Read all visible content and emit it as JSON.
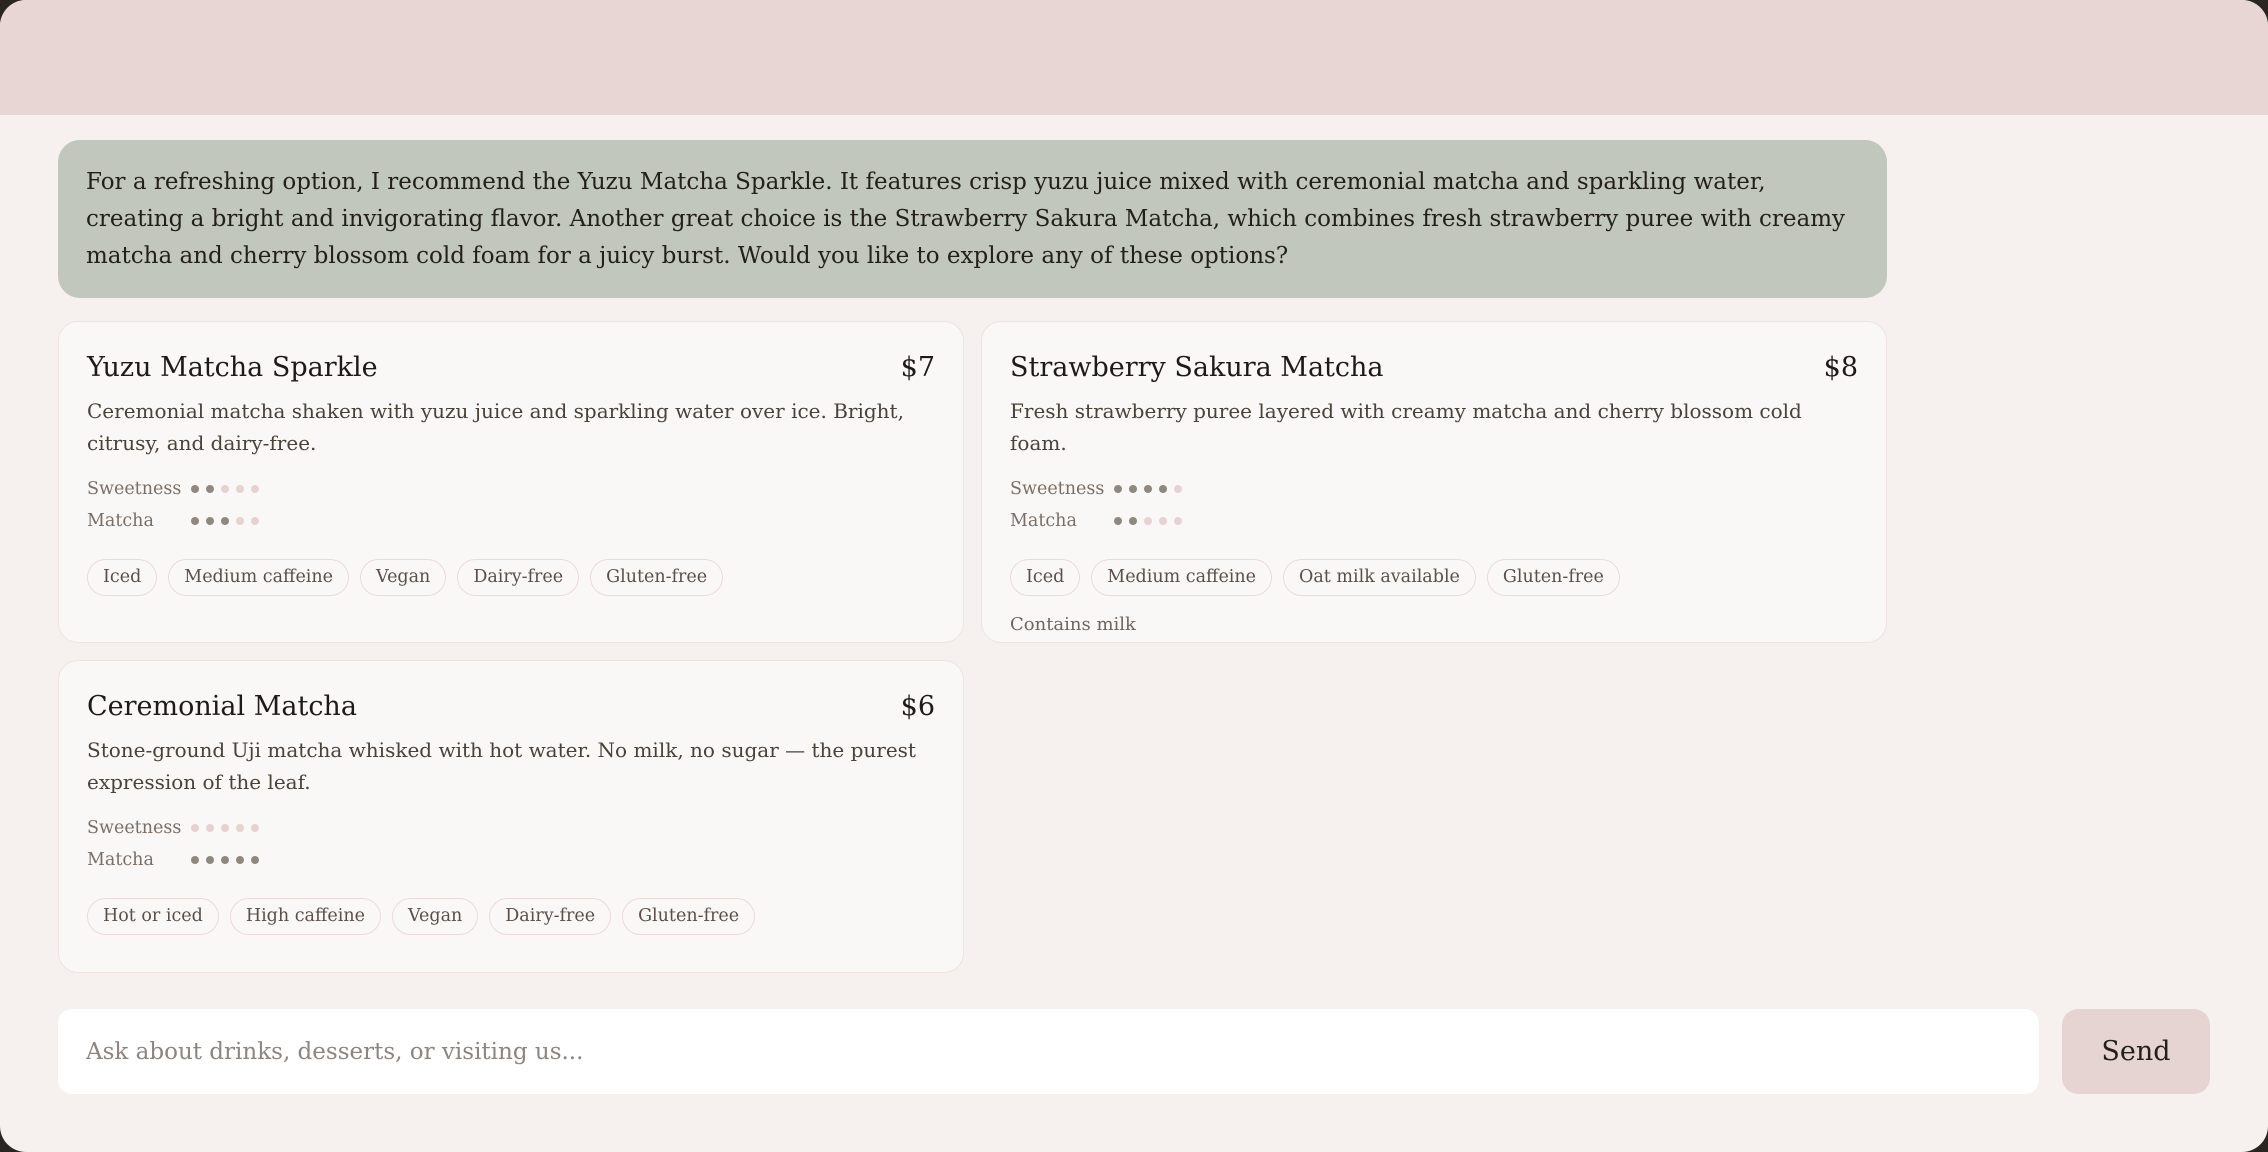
{
  "assistant_message": "For a refreshing option, I recommend the Yuzu Matcha Sparkle. It features crisp yuzu juice mixed with ceremonial matcha and sparkling water, creating a bright and invigorating flavor. Another great choice is the Strawberry Sakura Matcha, which combines fresh strawberry puree with creamy matcha and cherry blossom cold foam for a juicy burst. Would you like to explore any of these options?",
  "cards": [
    {
      "title": "Yuzu Matcha Sparkle",
      "price": "$7",
      "description": "Ceremonial matcha shaken with yuzu juice and sparkling water over ice. Bright, citrusy, and dairy-free.",
      "sweetness_label": "Sweetness",
      "sweetness_level": 2,
      "matcha_label": "Matcha",
      "matcha_level": 3,
      "tags": [
        "Iced",
        "Medium caffeine",
        "Vegan",
        "Dairy-free",
        "Gluten-free"
      ]
    },
    {
      "title": "Strawberry Sakura Matcha",
      "price": "$8",
      "description": "Fresh strawberry puree layered with creamy matcha and cherry blossom cold foam.",
      "sweetness_label": "Sweetness",
      "sweetness_level": 4,
      "matcha_label": "Matcha",
      "matcha_level": 2,
      "tags": [
        "Iced",
        "Medium caffeine",
        "Oat milk available",
        "Gluten-free"
      ],
      "note": "Contains milk"
    },
    {
      "title": "Ceremonial Matcha",
      "price": "$6",
      "description": "Stone-ground Uji matcha whisked with hot water. No milk, no sugar — the purest expression of the leaf.",
      "sweetness_label": "Sweetness",
      "sweetness_level": 0,
      "matcha_label": "Matcha",
      "matcha_level": 5,
      "tags": [
        "Hot or iced",
        "High caffeine",
        "Vegan",
        "Dairy-free",
        "Gluten-free"
      ]
    }
  ],
  "meter_max": 5,
  "composer": {
    "placeholder": "Ask about drinks, desserts, or visiting us...",
    "value": "",
    "send_label": "Send"
  },
  "colors": {
    "header_band": "#e8d6d5",
    "message_bubble": "#c1c7bc",
    "background": "#f6f1ee",
    "dot_on": "#8f8880",
    "dot_off": "#e6d3d1",
    "send_button": "#e6d4d3"
  }
}
